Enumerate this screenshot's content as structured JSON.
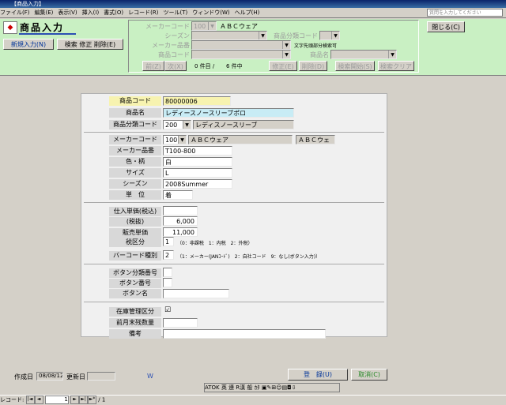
{
  "window": {
    "title": "【商品入力】"
  },
  "menu": {
    "items": [
      "ファイル(F)",
      "編集(E)",
      "表示(V)",
      "挿入(I)",
      "書式(O)",
      "レコード(R)",
      "ツール(T)",
      "ウィンドウ(W)",
      "ヘルプ(H)"
    ],
    "help_placeholder": "質問を入力してください"
  },
  "header": {
    "title": "商品入力",
    "new_entry": "新規入力(N)",
    "modes": "検索 修正 削除(E)",
    "close": "閉じる(C)"
  },
  "search": {
    "maker_code_label": "メーカーコード",
    "maker_code_value": "100",
    "maker_name": "ＡＢＣウェア",
    "season_label": "シーズン",
    "category_code_label": "商品分類コード",
    "maker_part_label": "メーカー品番",
    "prefix_note": "文字先頭部分検索可",
    "product_code_label": "商品コード",
    "product_name_label": "商品名",
    "prev": "前(Z)",
    "next": "次(X)",
    "count": "0 件目 /",
    "total": "6 件中",
    "edit": "修正(E)",
    "delete": "削除(D)",
    "start": "検索開始(S)",
    "clear": "検索クリア"
  },
  "form": {
    "product_code": {
      "label": "商品コード",
      "value": "80000006"
    },
    "product_name": {
      "label": "商品名",
      "value": "レディースノースリーブポロ"
    },
    "category": {
      "label": "商品分類コード",
      "code": "200",
      "name": "レディスノースリーブ"
    },
    "maker": {
      "label": "メーカーコード",
      "code": "100",
      "name": "ＡＢＣウェア",
      "short": "ＡＢＣウェ"
    },
    "maker_part": {
      "label": "メーカー品番",
      "value": "T100-800"
    },
    "color": {
      "label": "色・柄",
      "value": "白"
    },
    "size": {
      "label": "サイズ",
      "value": "L"
    },
    "season": {
      "label": "シーズン",
      "value": "2008Summer"
    },
    "unit": {
      "label": "単　位",
      "value": "着"
    },
    "cost_incl": {
      "label": "仕入単価(税込)",
      "value": ""
    },
    "cost_excl": {
      "label": "(税抜)",
      "value": "6,000"
    },
    "sale_price": {
      "label": "販売単価",
      "value": "11,000"
    },
    "tax_type": {
      "label": "税区分",
      "value": "1",
      "note": "（0：非課税　1：内税　2：外税）"
    },
    "barcode_type": {
      "label": "バーコード種別",
      "value": "2",
      "note": "（1：メーカー(JANｺｰﾄﾞ)　2：自社コード　9：なし(ボタン入力)）"
    },
    "button_category": {
      "label": "ボタン分類番号",
      "value": ""
    },
    "button_no": {
      "label": "ボタン番号",
      "value": ""
    },
    "button_name": {
      "label": "ボタン名",
      "value": ""
    },
    "stock_managed": {
      "label": "在庫管理区分",
      "value": "☑"
    },
    "prev_month_qty": {
      "label": "前月末残数量",
      "value": ""
    },
    "remarks": {
      "label": "備考",
      "value": ""
    }
  },
  "footer": {
    "created_label": "作成日",
    "created_date": "08/08/12",
    "updated_label": "更新日",
    "updated_date": "",
    "mark": "W",
    "register": "登　録(U)",
    "cancel": "取消(C)"
  },
  "statusbar": {
    "record_label": "レコード:",
    "current": "1",
    "total": "/ 1"
  },
  "ime": {
    "label": "ATOK 英 連 R漢 般 ｶﾀ"
  }
}
